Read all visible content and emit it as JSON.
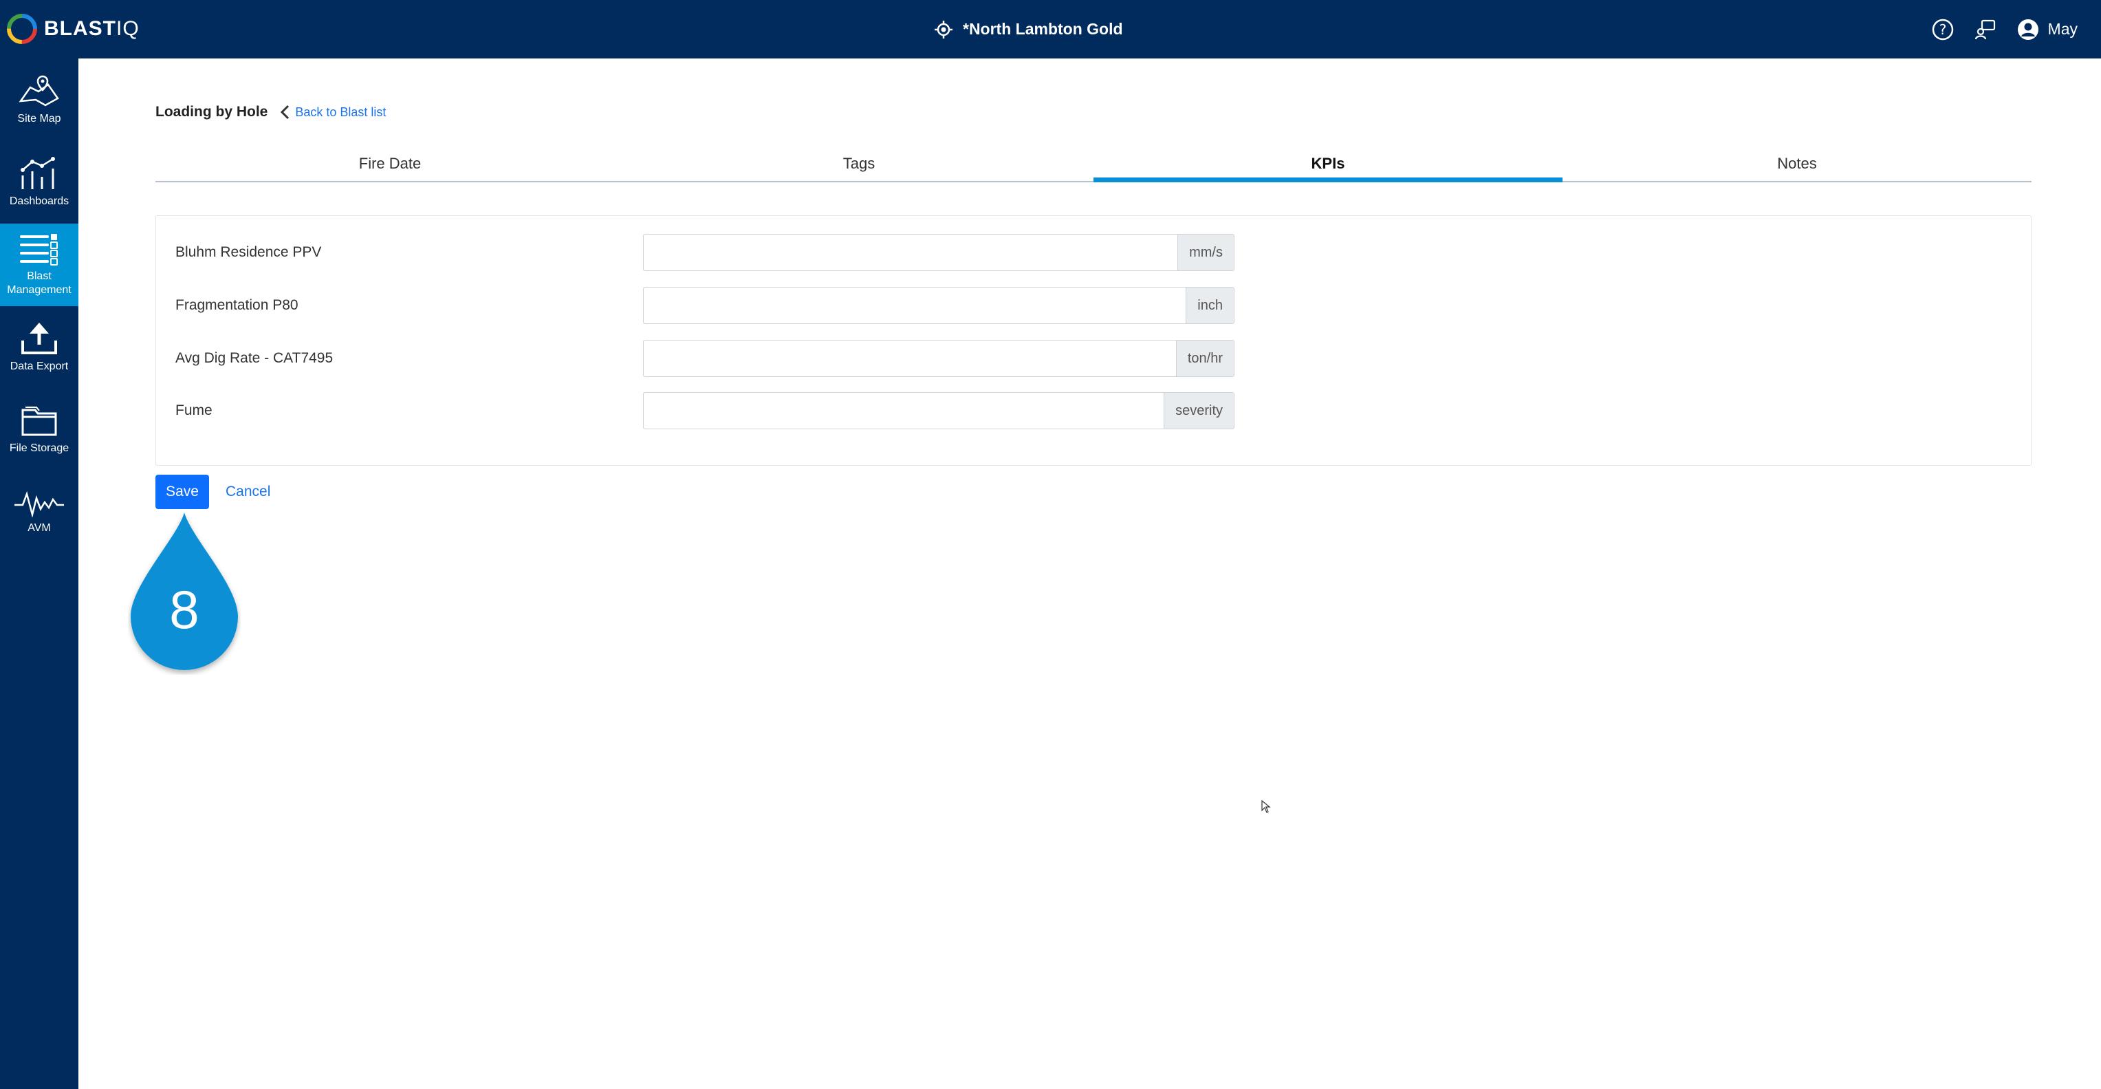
{
  "app": {
    "logo_main": "BLAST",
    "logo_iq": "IQ",
    "site_name": "*North Lambton Gold",
    "user_name": "May"
  },
  "sidebar": {
    "items": [
      {
        "label": "Site Map",
        "icon": "site-map-icon"
      },
      {
        "label": "Dashboards",
        "icon": "dashboard-icon"
      },
      {
        "label": "Blast Management",
        "icon": "blast-management-icon",
        "active": true
      },
      {
        "label": "Data Export",
        "icon": "upload-icon"
      },
      {
        "label": "File Storage",
        "icon": "folder-icon"
      },
      {
        "label": "AVM",
        "icon": "waveform-icon"
      }
    ]
  },
  "page": {
    "title": "Loading by Hole",
    "back_label": "Back to Blast list"
  },
  "tabs": [
    {
      "label": "Fire Date"
    },
    {
      "label": "Tags"
    },
    {
      "label": "KPIs",
      "active": true
    },
    {
      "label": "Notes"
    }
  ],
  "kpis": [
    {
      "label": "Bluhm Residence PPV",
      "value": "",
      "unit": "mm/s"
    },
    {
      "label": "Fragmentation P80",
      "value": "",
      "unit": "inch"
    },
    {
      "label": "Avg Dig Rate - CAT7495",
      "value": "",
      "unit": "ton/hr"
    },
    {
      "label": "Fume",
      "value": "",
      "unit": "severity"
    }
  ],
  "actions": {
    "save_label": "Save",
    "cancel_label": "Cancel"
  },
  "step_marker": {
    "number": "8",
    "color": "#0a8fd6"
  },
  "colors": {
    "header_bg": "#002b5c",
    "active_nav": "#0094d4",
    "primary_button": "#0d6efd",
    "link": "#1a73e8"
  }
}
